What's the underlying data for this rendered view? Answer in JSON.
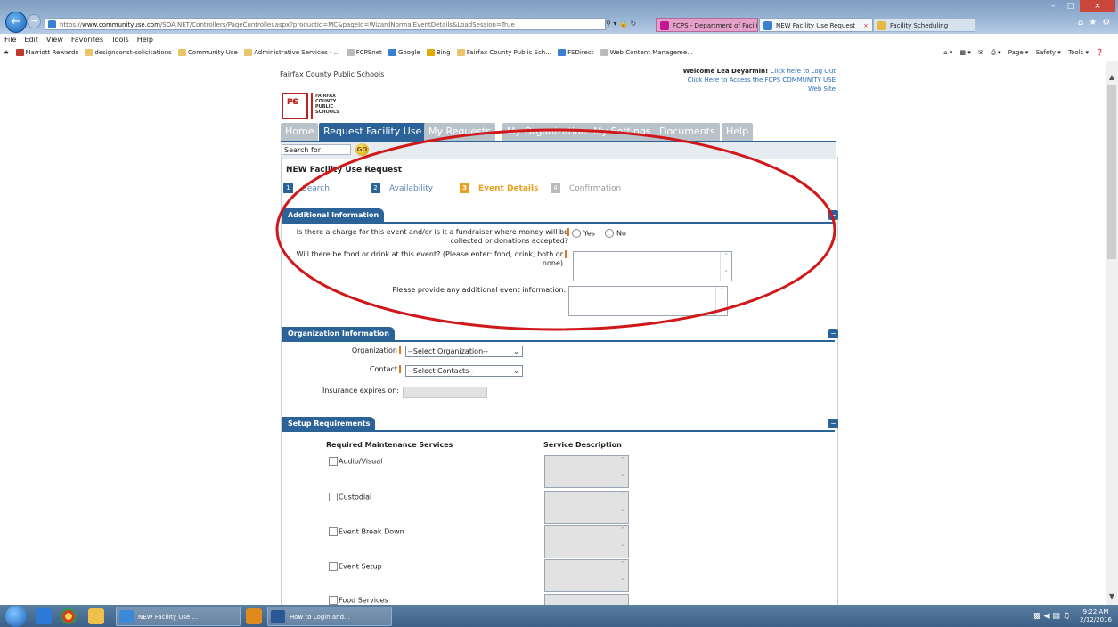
{
  "browser": {
    "url_prefix": "https://",
    "url_domain": "www.communityuse.com",
    "url_path": "/SOA.NET/Controllers/PageController.aspx?productId=MC&pageId=WizardNormalEventDetails&LoadSession=True",
    "tabs": [
      "FCPS - Department of Facilities...",
      "NEW Facility Use Request",
      "Facility Scheduling"
    ],
    "menu": [
      "File",
      "Edit",
      "View",
      "Favorites",
      "Tools",
      "Help"
    ],
    "favorites": [
      "Marriott Rewards",
      "designconst-solicitations",
      "Community Use",
      "Administrative Services - ...",
      "FCPSnet",
      "Google",
      "Bing",
      "Fairfax County Public Sch...",
      "FSDirect",
      "Web Content Manageme..."
    ],
    "commands": [
      "Page ▾",
      "Safety ▾",
      "Tools ▾"
    ]
  },
  "header": {
    "org_name": "Fairfax County Public Schools",
    "welcome": "Welcome Lea Deyarmin!",
    "logout_link": "Click here to Log Out",
    "community_link": "Click Here to Access the FCPS COMMUNITY USE Web Site",
    "logo_letters": [
      "FC",
      "PS"
    ],
    "logo_words": [
      "FAIRFAX",
      "COUNTY",
      "PUBLIC",
      "SCHOOLS"
    ]
  },
  "nav_tabs": [
    "Home",
    "Request Facility Use",
    "My Requests",
    "My Organizations",
    "My Settings",
    "Documents",
    "Help"
  ],
  "search": {
    "placeholder": "Search for",
    "go": "GO"
  },
  "request": {
    "title": "NEW Facility Use Request",
    "steps": [
      {
        "num": "1",
        "label": "Search"
      },
      {
        "num": "2",
        "label": "Availability"
      },
      {
        "num": "3",
        "label": "Event Details"
      },
      {
        "num": "4",
        "label": "Confirmation"
      }
    ]
  },
  "additional_info": {
    "header": "Additional Information",
    "q_charge_1": "Is there a charge for this event and/or is it a fundraiser where money will be",
    "q_charge_2": "collected or donations accepted?",
    "yes": "Yes",
    "no": "No",
    "q_food_1": "Will there be food or drink at this event? (Please enter: food, drink, both or",
    "q_food_2": "none)",
    "q_additional": "Please provide any additional event information."
  },
  "organization_info": {
    "header": "Organization Information",
    "org_label": "Organization",
    "org_value": "--Select Organization--",
    "contact_label": "Contact",
    "contact_value": "--Select Contacts--",
    "insurance_label": "Insurance expires on:"
  },
  "setup": {
    "header": "Setup Requirements",
    "col1": "Required Maintenance Services",
    "col2": "Service Description",
    "services": [
      "Audio/Visual",
      "Custodial",
      "Event Break Down",
      "Event Setup",
      "Food Services"
    ]
  },
  "taskbar": {
    "tasks": [
      "NEW Facility Use ...",
      "How to Login and..."
    ],
    "time": "9:22 AM",
    "date": "2/12/2016"
  },
  "colors": {
    "brand_blue": "#2b6398",
    "step_active": "#e8a020",
    "annotation": "#d0181b"
  }
}
